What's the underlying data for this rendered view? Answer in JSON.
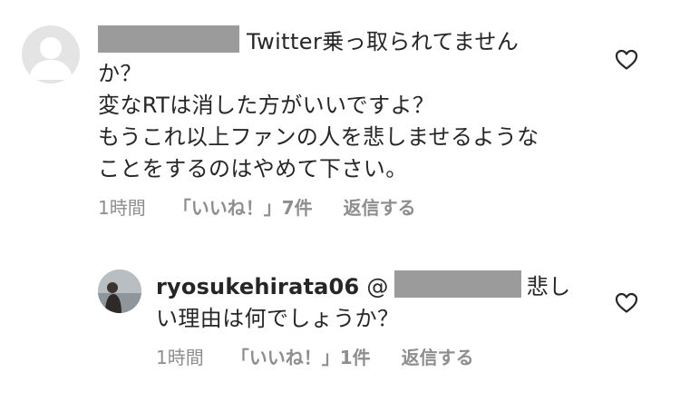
{
  "comment1": {
    "text_line1": "Twitter乗っ取られてません",
    "text_line2": "か？",
    "text_line3": "変なRTは消した方がいいですよ？",
    "text_line4": "もうこれ以上ファンの人を悲しませるような",
    "text_line5": "ことをするのはやめて下さい。",
    "time": "1時間",
    "likes": "「いいね！」7件",
    "reply_label": "返信する",
    "like_icon": "heart-outline-icon"
  },
  "comment2": {
    "username": "ryosukehirata06",
    "mention_prefix": "@",
    "text_line1_suffix": "悲し",
    "text_line2": "い理由は何でしょうか？",
    "time": "1時間",
    "likes": "「いいね！」1件",
    "reply_label": "返信する",
    "like_icon": "heart-outline-icon"
  },
  "colors": {
    "text": "#262626",
    "meta": "#8e8e8e",
    "redaction": "#9b9b9b",
    "default_avatar_bg": "#e4e4e4",
    "default_avatar_fg": "#ffffff"
  }
}
